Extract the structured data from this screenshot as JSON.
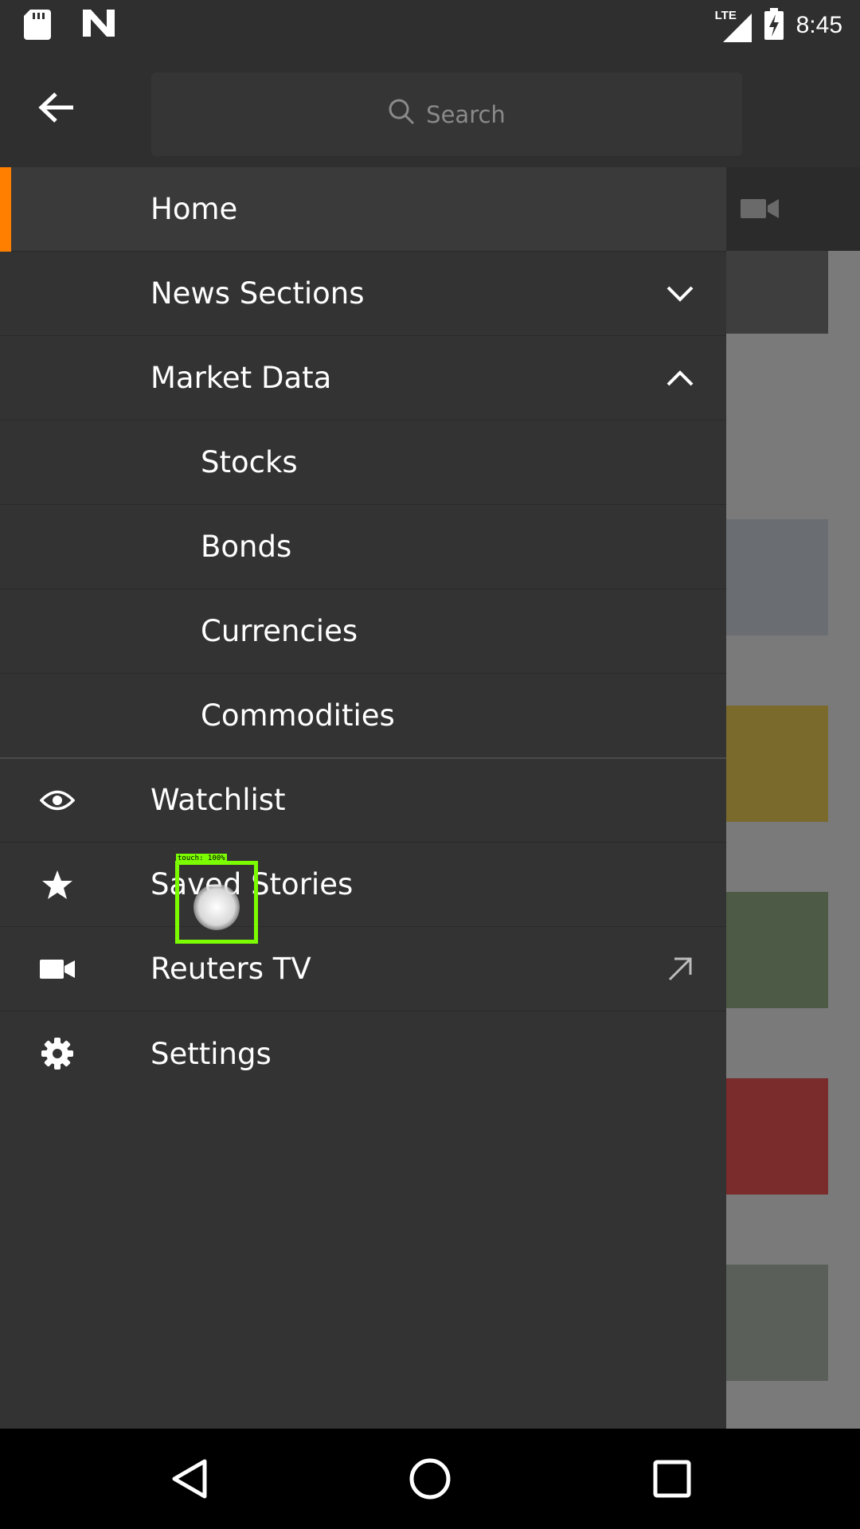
{
  "status_bar": {
    "network": "LTE",
    "time": "8:45",
    "icons": [
      "sd-card-icon",
      "n-logo-icon",
      "lte-signal-icon",
      "battery-charging-icon"
    ]
  },
  "top_bar": {
    "back_icon": "arrow-left-icon",
    "search": {
      "placeholder": "Search",
      "icon": "search-icon"
    }
  },
  "drawer": {
    "accent_color": "#ff8000",
    "items": [
      {
        "label": "Home",
        "active": true
      },
      {
        "label": "News Sections",
        "trailing_icon": "chevron-down-icon"
      },
      {
        "label": "Market Data",
        "trailing_icon": "chevron-up-icon",
        "expanded": true
      },
      {
        "label": "Stocks",
        "sub": true
      },
      {
        "label": "Bonds",
        "sub": true
      },
      {
        "label": "Currencies",
        "sub": true
      },
      {
        "label": "Commodities",
        "sub": true
      },
      {
        "label": "Watchlist",
        "icon": "eye-icon"
      },
      {
        "label": "Saved Stories",
        "icon": "star-icon"
      },
      {
        "label": "Reuters TV",
        "icon": "video-camera-icon",
        "trailing_icon": "external-link-arrow-icon"
      },
      {
        "label": "Settings",
        "icon": "gear-icon"
      }
    ]
  },
  "touch_indicator": {
    "label": "touch: 100%"
  },
  "nav_bar": {
    "buttons": [
      "back-triangle-icon",
      "home-circle-icon",
      "recents-square-icon"
    ]
  }
}
